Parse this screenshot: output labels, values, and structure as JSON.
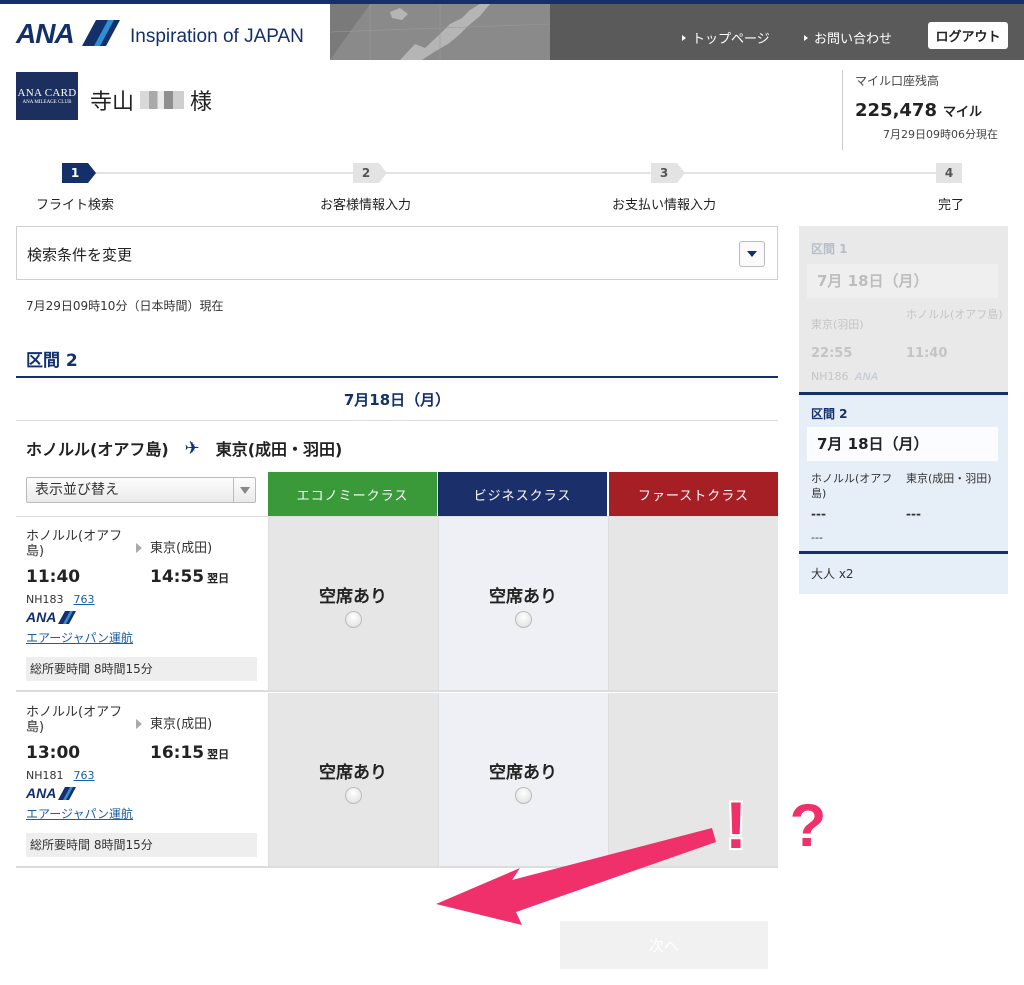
{
  "header": {
    "logo": "ANA",
    "tagline": "Inspiration of JAPAN",
    "nav": [
      "トップページ",
      "お問い合わせ"
    ],
    "logout_label": "ログアウト",
    "brand_color": "#13306b"
  },
  "user": {
    "card_logo_line1": "ANA CARD",
    "card_logo_line2": "ANA MILEAGE CLUB",
    "surname": "寺山",
    "honorific": "様"
  },
  "miles": {
    "title": "マイル口座残高",
    "value": "225,478",
    "unit": "マイル",
    "as_of": "7月29日09時06分現在"
  },
  "steps": [
    {
      "num": "1",
      "label": "フライト検索",
      "active": true
    },
    {
      "num": "2",
      "label": "お客様情報入力",
      "active": false
    },
    {
      "num": "3",
      "label": "お支払い情報入力",
      "active": false
    },
    {
      "num": "4",
      "label": "完了",
      "active": false
    }
  ],
  "search": {
    "change_label": "検索条件を変更",
    "current_time": "7月29日09時10分（日本時間）現在"
  },
  "segment": {
    "title": "区間 2",
    "date": "7月18日（月）",
    "origin": "ホノルル(オアフ島)",
    "destination": "東京(成田・羽田)"
  },
  "sort_label": "表示並び替え",
  "classes": [
    {
      "label": "エコノミークラス",
      "color": "#3a9a3a"
    },
    {
      "label": "ビジネスクラス",
      "color": "#1b2f6b"
    },
    {
      "label": "ファーストクラス",
      "color": "#a51f25"
    }
  ],
  "flights": [
    {
      "from": "ホノルル(オアフ島)",
      "to": "東京(成田)",
      "dep": "11:40",
      "arr": "14:55",
      "next_day": "翌日",
      "flight_no": "NH183",
      "aircraft": "763",
      "operator": "エアージャパン運航",
      "duration": "総所要時間 8時間15分",
      "economy": "空席あり",
      "business": "空席あり"
    },
    {
      "from": "ホノルル(オアフ島)",
      "to": "東京(成田)",
      "dep": "13:00",
      "arr": "16:15",
      "next_day": "翌日",
      "flight_no": "NH181",
      "aircraft": "763",
      "operator": "エアージャパン運航",
      "duration": "総所要時間 8時間15分",
      "economy": "空席あり",
      "business": "空席あり"
    }
  ],
  "summary": {
    "seg1": {
      "title": "区間 1",
      "date": "7月 18日（月）",
      "from": "東京(羽田)",
      "to": "ホノルル(オアフ島)",
      "dep": "22:55",
      "arr": "11:40",
      "flight_no": "NH186"
    },
    "seg2": {
      "title": "区間 2",
      "date": "7月 18日（月）",
      "from": "ホノルル(オアフ島)",
      "to": "東京(成田・羽田)",
      "dep": "---",
      "arr": "---",
      "flight_no": "---"
    },
    "pax": "大人 x2"
  },
  "next_label": "次へ",
  "annotation": {
    "exclaim": "!",
    "question": "?",
    "color": "#f0306a"
  }
}
